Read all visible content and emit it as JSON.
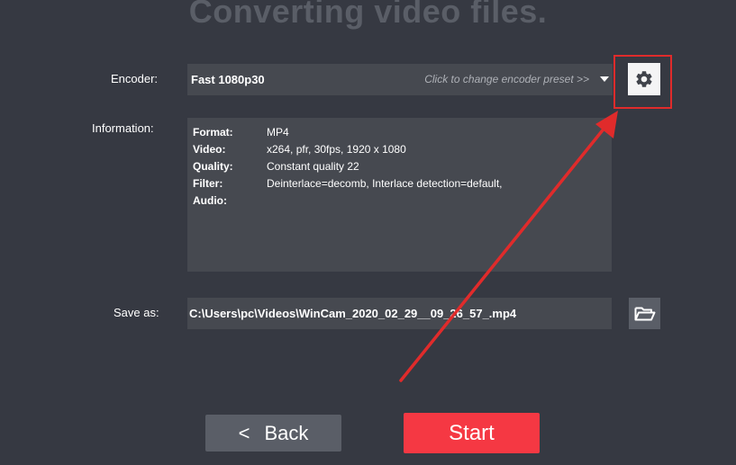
{
  "page": {
    "title": "Converting video files."
  },
  "encoder": {
    "label": "Encoder:",
    "value": "Fast 1080p30",
    "hint": "Click to change encoder preset >>",
    "settings_icon": "gear-icon"
  },
  "information": {
    "label": "Information:",
    "rows": [
      {
        "key": "Format:",
        "value": "MP4"
      },
      {
        "key": "Video:",
        "value": "x264, pfr, 30fps, 1920 x 1080"
      },
      {
        "key": "Quality:",
        "value": "Constant quality 22"
      },
      {
        "key": "Filter:",
        "value": "Deinterlace=decomb, Interlace detection=default,"
      },
      {
        "key": "Audio:",
        "value": ""
      }
    ]
  },
  "save_as": {
    "label": "Save as:",
    "value": "C:\\Users\\pc\\Videos\\WinCam_2020_02_29__09_26_57_.mp4",
    "browse_icon": "folder-open-icon"
  },
  "buttons": {
    "back_chevron": "<",
    "back_label": "Back",
    "start_label": "Start"
  },
  "colors": {
    "background": "#363942",
    "field": "#464950",
    "start": "#f53843",
    "highlight": "#e02b2b"
  }
}
